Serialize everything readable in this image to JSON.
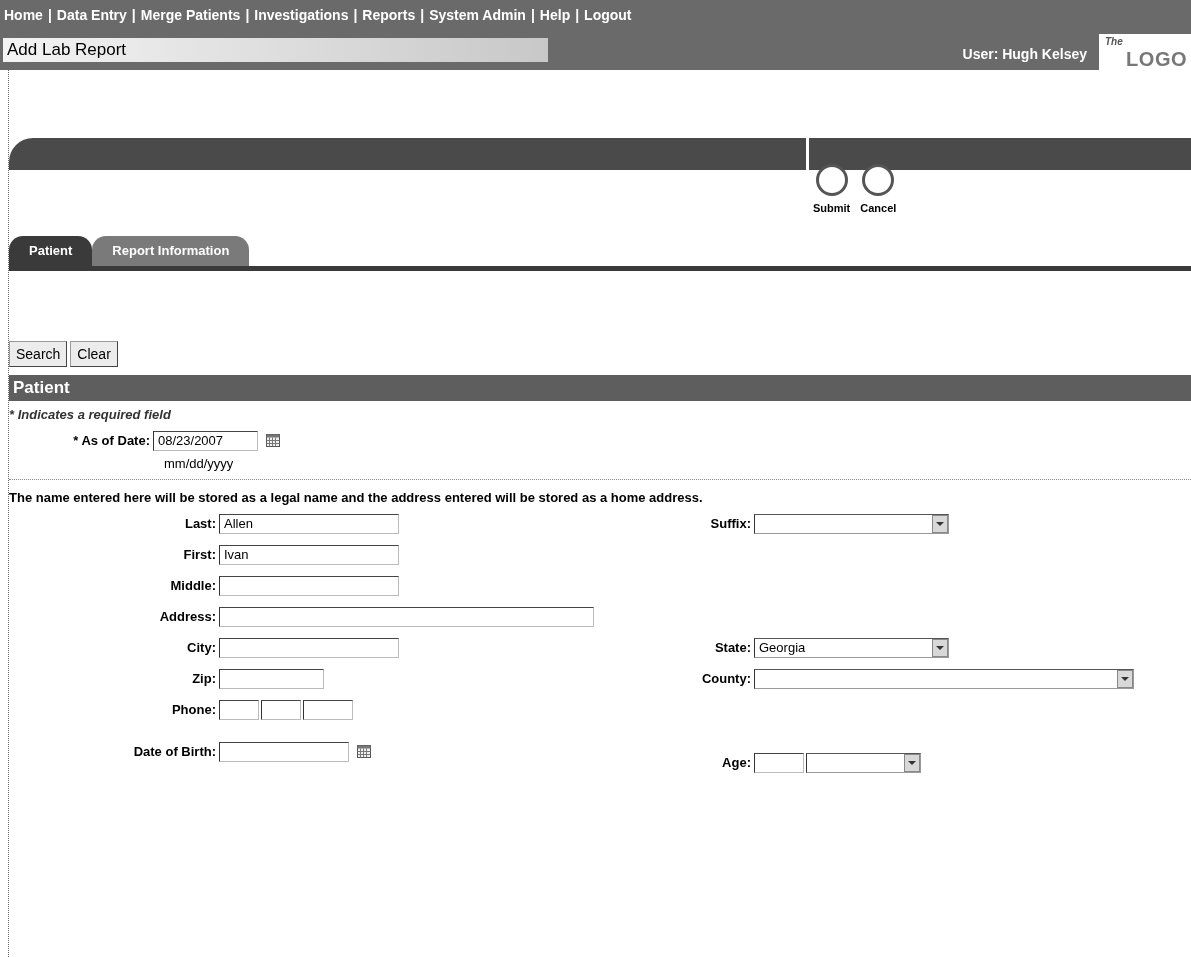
{
  "nav": {
    "separator": "|",
    "items": [
      {
        "label": "Home"
      },
      {
        "label": "Data Entry"
      },
      {
        "label": "Merge Patients"
      },
      {
        "label": "Investigations"
      },
      {
        "label": "Reports"
      },
      {
        "label": "System Admin"
      },
      {
        "label": "Help"
      },
      {
        "label": "Logout"
      }
    ]
  },
  "page_title": "Add Lab Report",
  "user": "User: Hugh Kelsey",
  "logo": {
    "small": "The",
    "main": "LOGO"
  },
  "actions": [
    {
      "label": "Submit"
    },
    {
      "label": "Cancel"
    }
  ],
  "tabs": [
    {
      "label": "Patient",
      "selected": true
    },
    {
      "label": "Report Information",
      "selected": false
    }
  ],
  "buttons": [
    {
      "label": "Search"
    },
    {
      "label": "Clear"
    }
  ],
  "section": {
    "title": "Patient",
    "required_note": "* Indicates a required field",
    "as_of_date": {
      "label": "* As of Date:",
      "value": "08/23/2007",
      "format": "mm/dd/yyyy"
    },
    "notice": "The name entered here will be stored as a legal name and the address entered will be stored as a home address."
  },
  "rows": [
    {
      "left": {
        "label": "Last:",
        "kind": "text",
        "value": "Allen"
      },
      "right": {
        "label": "Suffix:",
        "kind": "select"
      }
    },
    {
      "left": {
        "label": "First:",
        "kind": "text",
        "value": "Ivan"
      }
    },
    {
      "left": {
        "label": "Middle:",
        "kind": "text"
      }
    },
    {
      "left": {
        "label": "Address:",
        "kind": "wide_text"
      }
    },
    {
      "left": {
        "label": "City:",
        "kind": "text"
      },
      "right": {
        "label": "State:",
        "kind": "select",
        "value": "Georgia"
      }
    },
    {
      "left": {
        "label": "Zip:",
        "kind": "short_text"
      },
      "right": {
        "label": "County:",
        "kind": "wide_select"
      }
    },
    {
      "left": {
        "label": "Phone:",
        "kind": "phone"
      }
    },
    {
      "left": {
        "label": "Date of Birth:",
        "kind": "date"
      },
      "right": {
        "label": "Age:",
        "kind": "age"
      }
    }
  ]
}
